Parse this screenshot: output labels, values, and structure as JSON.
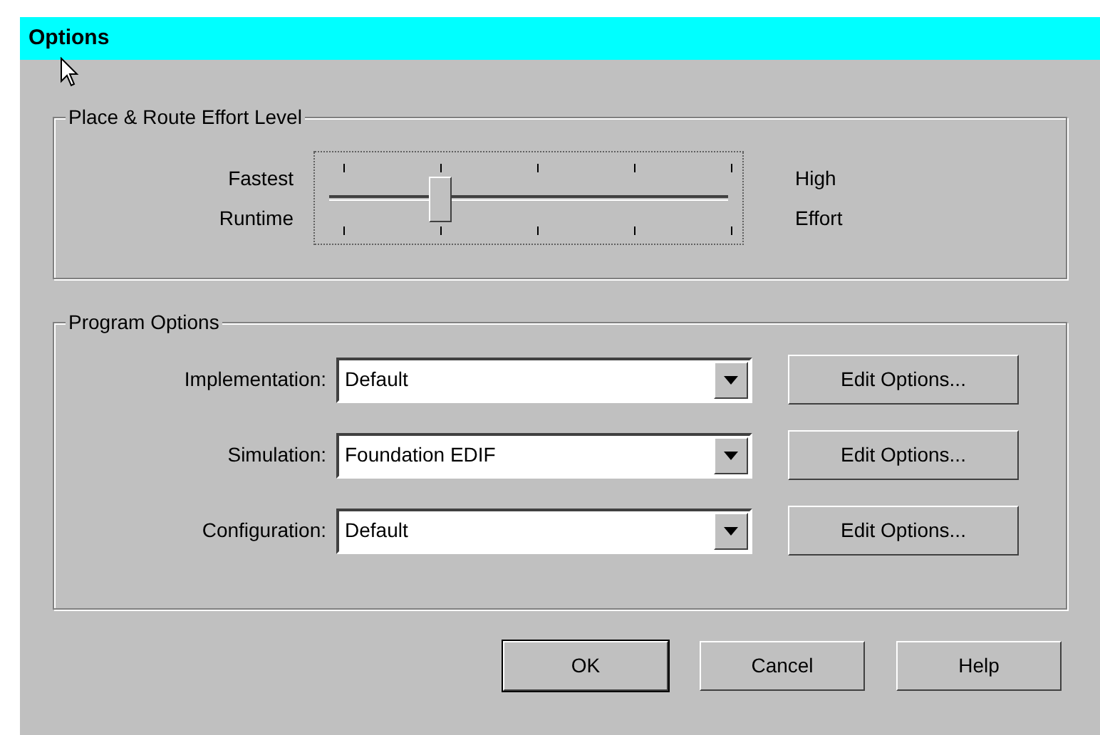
{
  "window": {
    "title": "Options"
  },
  "effort": {
    "title": "Place & Route Effort Level",
    "left_label": {
      "line1": "Fastest",
      "line2": "Runtime"
    },
    "right_label": {
      "line1": "High",
      "line2": "Effort"
    },
    "level": 0.25
  },
  "program_options": {
    "title": "Program Options",
    "rows": [
      {
        "label": "Implementation:",
        "value": "Default",
        "button": "Edit Options..."
      },
      {
        "label": "Simulation:",
        "value": "Foundation EDIF",
        "button": "Edit Options..."
      },
      {
        "label": "Configuration:",
        "value": "Default",
        "button": "Edit Options..."
      }
    ]
  },
  "buttons": [
    {
      "label": "OK",
      "default": true
    },
    {
      "label": "Cancel",
      "default": false
    },
    {
      "label": "Help",
      "default": false
    }
  ]
}
